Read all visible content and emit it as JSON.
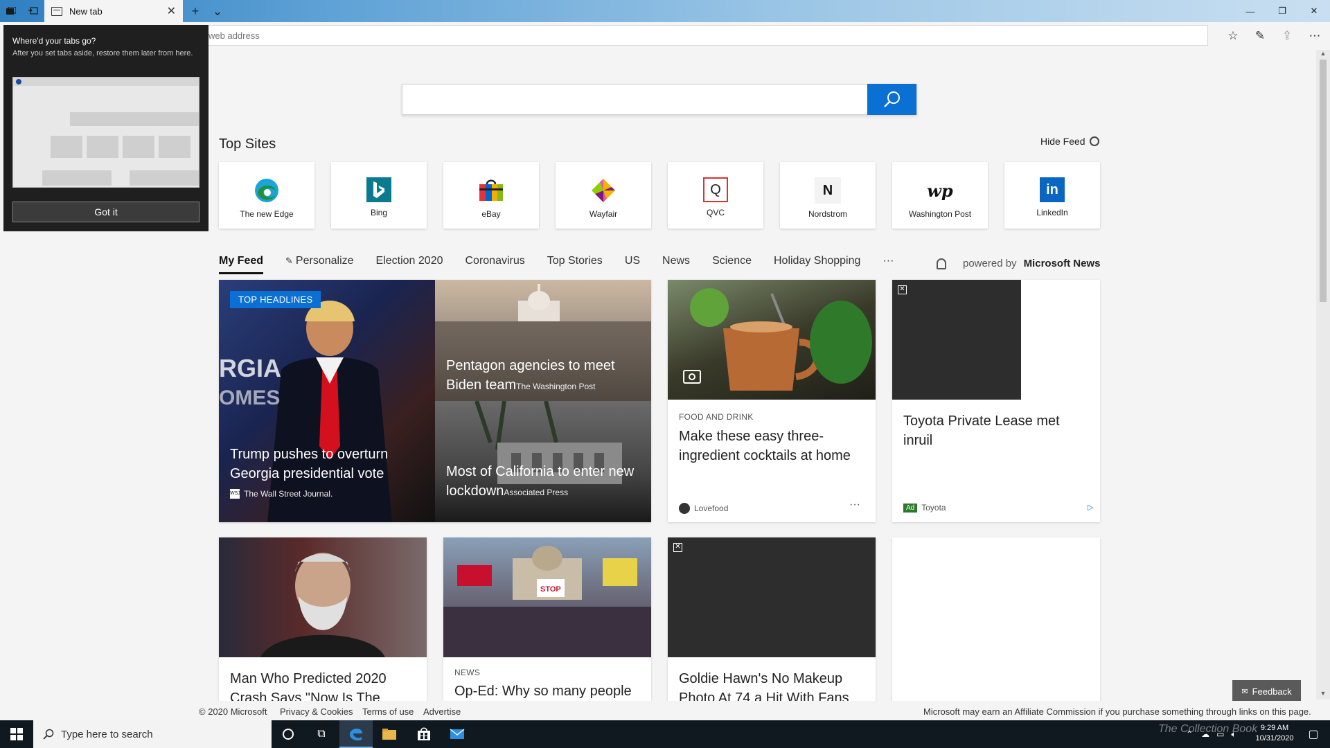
{
  "tabbar": {
    "tab_title": "New tab",
    "new_tab_glyph": "+",
    "tab_list_glyph": "⌄"
  },
  "addressbar": {
    "placeholder": "web address"
  },
  "search": {
    "placeholder": ""
  },
  "top_sites": {
    "title": "Top Sites",
    "hide_feed": "Hide Feed",
    "sites": [
      {
        "label": "The new Edge",
        "icon": "edge-logo-icon",
        "color": "#1ba4d6"
      },
      {
        "label": "Bing",
        "icon": "bing-logo-icon",
        "color": "#0a7a8f"
      },
      {
        "label": "eBay",
        "icon": "ebay-bag-icon",
        "color": "#e53238"
      },
      {
        "label": "Wayfair",
        "icon": "wayfair-logo-icon",
        "color": "#7f187f"
      },
      {
        "label": "QVC",
        "icon": "qvc-logo-icon",
        "color": "#d9342b"
      },
      {
        "label": "Nordstrom",
        "icon": "nordstrom-logo-icon",
        "color": "#111111"
      },
      {
        "label": "Washington Post",
        "icon": "washington-post-logo-icon",
        "color": "#111111"
      },
      {
        "label": "LinkedIn",
        "icon": "linkedin-logo-icon",
        "color": "#0a66c2"
      }
    ]
  },
  "feed_nav": {
    "items": [
      "My Feed",
      "Personalize",
      "Election 2020",
      "Coronavirus",
      "Top Stories",
      "US",
      "News",
      "Science",
      "Holiday Shopping",
      "···"
    ],
    "powered_by_prefix": "powered by",
    "powered_by_brand": "Microsoft News"
  },
  "hero": {
    "badge": "TOP HEADLINES",
    "main_title": "Trump pushes to overturn Georgia presidential vote",
    "main_source": "The Wall Street Journal.",
    "side_items": [
      {
        "title": "Pentagon agencies to meet Biden team",
        "source": "The Washington Post"
      },
      {
        "title": "Most of California to enter new lockdown",
        "source": "Associated Press"
      }
    ],
    "dot_count": 33,
    "active_dot": 0
  },
  "cards_row1": [
    {
      "category": "FOOD AND DRINK",
      "title": "Make these easy three-ingredient cocktails at home",
      "source": "Lovefood",
      "more": "···"
    },
    {
      "title": "Toyota Private Lease met inruil",
      "ad_label": "Ad",
      "source": "Toyota"
    }
  ],
  "cards_row2": [
    {
      "title": "Man Who Predicted 2020 Crash Says \"Now Is The",
      "category": ""
    },
    {
      "category": "NEWS",
      "title": "Op-Ed: Why so many people"
    },
    {
      "title": "Goldie Hawn's No Makeup Photo At 74 a Hit With Fans"
    }
  ],
  "footer": {
    "copyright": "© 2020 Microsoft",
    "privacy": "Privacy & Cookies",
    "terms": "Terms of use",
    "advertise": "Advertise",
    "affiliate": "Microsoft may earn an Affiliate Commission if you purchase something through links on this page.",
    "feedback": "Feedback"
  },
  "popup": {
    "title": "Where'd your tabs go?",
    "description": "After you set tabs aside, restore them later from here.",
    "button": "Got it"
  },
  "taskbar": {
    "search_placeholder": "Type here to search",
    "time": "9:29 AM",
    "date": "10/31/2020",
    "watermark": "The Collection Book"
  },
  "colors": {
    "accent": "#0a70d4",
    "hero_badge": "#0a70d4"
  }
}
